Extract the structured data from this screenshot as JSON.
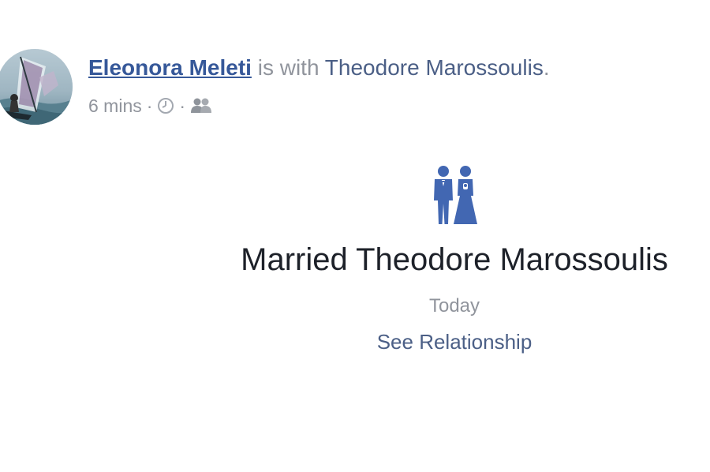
{
  "post": {
    "author": "Eleonora Meleti",
    "with_text": "is with",
    "tagged_person": "Theodore Marossoulis",
    "period": ".",
    "time_ago": "6 mins",
    "separator": "·",
    "icons": {
      "avatar": "windsurfer-photo",
      "time": "clock-icon",
      "audience": "friends-icon"
    },
    "colors": {
      "link": "#365899",
      "secondary_text": "#90949c",
      "icon": "#4267b2"
    }
  },
  "life_event": {
    "icon": "couple-icon",
    "title": "Married Theodore Marossoulis",
    "date": "Today",
    "link_label": "See Relationship"
  }
}
